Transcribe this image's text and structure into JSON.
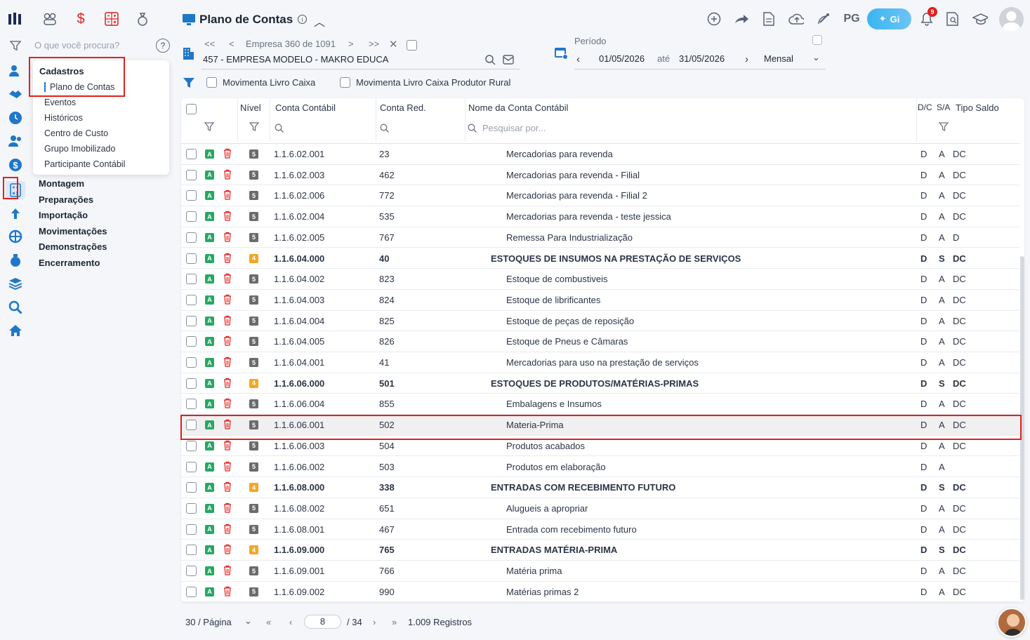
{
  "app": {
    "title": "Plano de Contas"
  },
  "sidebar": {
    "search_placeholder": "O que você procura?",
    "flyout": {
      "title": "Cadastros",
      "items": [
        "Plano de Contas",
        "Eventos",
        "Históricos",
        "Centro de Custo",
        "Grupo Imobilizado",
        "Participante Contábil"
      ]
    },
    "menu": [
      "Montagem",
      "Preparações",
      "Importação",
      "Movimentações",
      "Demonstrações",
      "Encerramento"
    ]
  },
  "company": {
    "nav_label": "Empresa 360 de 1091",
    "name": "457 - EMPRESA MODELO - MAKRO EDUCA"
  },
  "period": {
    "label": "Período",
    "start": "01/05/2026",
    "between": "até",
    "end": "31/05/2026",
    "mode": "Mensal"
  },
  "filters": {
    "livro_caixa": "Movimenta Livro Caixa",
    "livro_caixa_rural": "Movimenta Livro Caixa Produtor Rural"
  },
  "topbar": {
    "pg": "PG",
    "gi": "Gi",
    "notifications": "9"
  },
  "table": {
    "headers": {
      "nivel": "Nível",
      "conta": "Conta Contábil",
      "red": "Conta Red.",
      "nome": "Nome da Conta Contábil",
      "dc": "D/C",
      "sa": "S/A",
      "tipo": "Tipo Saldo"
    },
    "name_search_placeholder": "Pesquisar por...",
    "rows": [
      {
        "lvl": "5",
        "conta": "1.1.6.02.001",
        "red": "23",
        "nome": "Mercadorias para revenda",
        "dc": "D",
        "sa": "A",
        "tipo": "DC"
      },
      {
        "lvl": "5",
        "conta": "1.1.6.02.003",
        "red": "462",
        "nome": "Mercadorias para revenda - Filial",
        "dc": "D",
        "sa": "A",
        "tipo": "DC"
      },
      {
        "lvl": "5",
        "conta": "1.1.6.02.006",
        "red": "772",
        "nome": "Mercadorias para revenda - Filial 2",
        "dc": "D",
        "sa": "A",
        "tipo": "DC"
      },
      {
        "lvl": "5",
        "conta": "1.1.6.02.004",
        "red": "535",
        "nome": "Mercadorias para revenda - teste jessica",
        "dc": "D",
        "sa": "A",
        "tipo": "DC"
      },
      {
        "lvl": "5",
        "conta": "1.1.6.02.005",
        "red": "767",
        "nome": "Remessa Para Industrialização",
        "dc": "D",
        "sa": "A",
        "tipo": "D"
      },
      {
        "lvl": "4",
        "conta": "1.1.6.04.000",
        "red": "40",
        "nome": "ESTOQUES DE INSUMOS NA PRESTAÇÃO DE SERVIÇOS",
        "dc": "D",
        "sa": "S",
        "tipo": "DC"
      },
      {
        "lvl": "5",
        "conta": "1.1.6.04.002",
        "red": "823",
        "nome": "Estoque de combustiveis",
        "dc": "D",
        "sa": "A",
        "tipo": "DC"
      },
      {
        "lvl": "5",
        "conta": "1.1.6.04.003",
        "red": "824",
        "nome": "Estoque de librificantes",
        "dc": "D",
        "sa": "A",
        "tipo": "DC"
      },
      {
        "lvl": "5",
        "conta": "1.1.6.04.004",
        "red": "825",
        "nome": "Estoque de peças de reposição",
        "dc": "D",
        "sa": "A",
        "tipo": "DC"
      },
      {
        "lvl": "5",
        "conta": "1.1.6.04.005",
        "red": "826",
        "nome": "Estoque de Pneus e Câmaras",
        "dc": "D",
        "sa": "A",
        "tipo": "DC"
      },
      {
        "lvl": "5",
        "conta": "1.1.6.04.001",
        "red": "41",
        "nome": "Mercadorias para uso na prestação de serviços",
        "dc": "D",
        "sa": "A",
        "tipo": "DC"
      },
      {
        "lvl": "4",
        "conta": "1.1.6.06.000",
        "red": "501",
        "nome": "ESTOQUES DE PRODUTOS/MATÉRIAS-PRIMAS",
        "dc": "D",
        "sa": "S",
        "tipo": "DC"
      },
      {
        "lvl": "5",
        "conta": "1.1.6.06.004",
        "red": "855",
        "nome": "Embalagens e Insumos",
        "dc": "D",
        "sa": "A",
        "tipo": "DC"
      },
      {
        "lvl": "5",
        "conta": "1.1.6.06.001",
        "red": "502",
        "nome": "Materia-Prima",
        "dc": "D",
        "sa": "A",
        "tipo": "DC"
      },
      {
        "lvl": "5",
        "conta": "1.1.6.06.003",
        "red": "504",
        "nome": "Produtos acabados",
        "dc": "D",
        "sa": "A",
        "tipo": "DC"
      },
      {
        "lvl": "5",
        "conta": "1.1.6.06.002",
        "red": "503",
        "nome": "Produtos em elaboração",
        "dc": "D",
        "sa": "A",
        "tipo": ""
      },
      {
        "lvl": "4",
        "conta": "1.1.6.08.000",
        "red": "338",
        "nome": "ENTRADAS COM RECEBIMENTO FUTURO",
        "dc": "D",
        "sa": "S",
        "tipo": "DC"
      },
      {
        "lvl": "5",
        "conta": "1.1.6.08.002",
        "red": "651",
        "nome": "Alugueis a apropriar",
        "dc": "D",
        "sa": "A",
        "tipo": "DC"
      },
      {
        "lvl": "5",
        "conta": "1.1.6.08.001",
        "red": "467",
        "nome": "Entrada com recebimento futuro",
        "dc": "D",
        "sa": "A",
        "tipo": "DC"
      },
      {
        "lvl": "4",
        "conta": "1.1.6.09.000",
        "red": "765",
        "nome": "ENTRADAS MATÉRIA-PRIMA",
        "dc": "D",
        "sa": "S",
        "tipo": "DC"
      },
      {
        "lvl": "5",
        "conta": "1.1.6.09.001",
        "red": "766",
        "nome": "Matéria prima",
        "dc": "D",
        "sa": "A",
        "tipo": "DC"
      },
      {
        "lvl": "5",
        "conta": "1.1.6.09.002",
        "red": "990",
        "nome": "Matérias primas 2",
        "dc": "D",
        "sa": "A",
        "tipo": "DC"
      }
    ],
    "row_badge": "A"
  },
  "pagination": {
    "per_page": "30 / Página",
    "current": "8",
    "total": "/ 34",
    "records": "1.009 Registros"
  },
  "colors": {
    "accent": "#1f77c8",
    "highlight": "#e0201d",
    "green": "#27a862",
    "orange": "#f5a623"
  }
}
